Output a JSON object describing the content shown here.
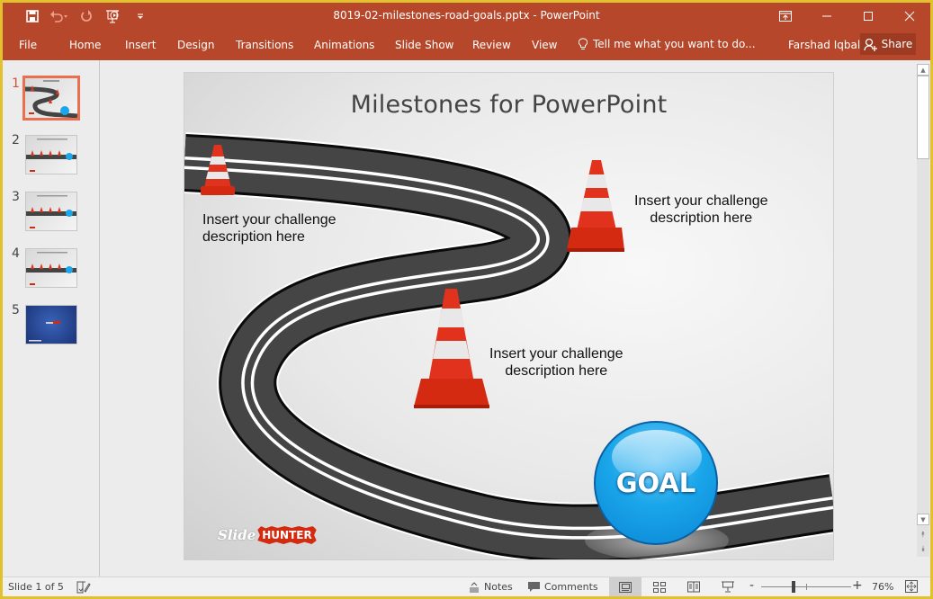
{
  "titlebar": {
    "document_title": "8019-02-milestones-road-goals.pptx - PowerPoint",
    "qat_icons": [
      "save-icon",
      "undo-icon",
      "redo-icon",
      "start-from-beginning-icon",
      "customize-qat-icon"
    ],
    "window_controls": [
      "ribbon-display-options-icon",
      "minimize-icon",
      "maximize-icon",
      "close-icon"
    ]
  },
  "ribbon": {
    "tabs": [
      "File",
      "Home",
      "Insert",
      "Design",
      "Transitions",
      "Animations",
      "Slide Show",
      "Review",
      "View"
    ],
    "tell_me": "Tell me what you want to do...",
    "user_name": "Farshad Iqbal",
    "share_label": "Share"
  },
  "thumbnails": {
    "numbers": [
      "1",
      "2",
      "3",
      "4",
      "5"
    ],
    "active_index": 1
  },
  "slide": {
    "title": "Milestones for PowerPoint",
    "captions": [
      {
        "line1": "Insert your challenge",
        "line2": "description here"
      },
      {
        "line1": "Insert your challenge",
        "line2": "description here"
      },
      {
        "line1": "Insert your challenge",
        "line2": "description here"
      }
    ],
    "goal_label": "GOAL",
    "logo": {
      "part1": "Slide",
      "part2": "HUNTER"
    }
  },
  "statusbar": {
    "slide_indicator": "Slide 1 of 5",
    "notes_label": "Notes",
    "comments_label": "Comments",
    "zoom_minus": "-",
    "zoom_plus": "+",
    "zoom_level": "76%"
  },
  "colors": {
    "accent": "#b7472a",
    "window_border": "#e2c12f",
    "active_thumb": "#e8704f",
    "goal_blue": "#1aa6ea",
    "cone_red": "#e0321c"
  }
}
